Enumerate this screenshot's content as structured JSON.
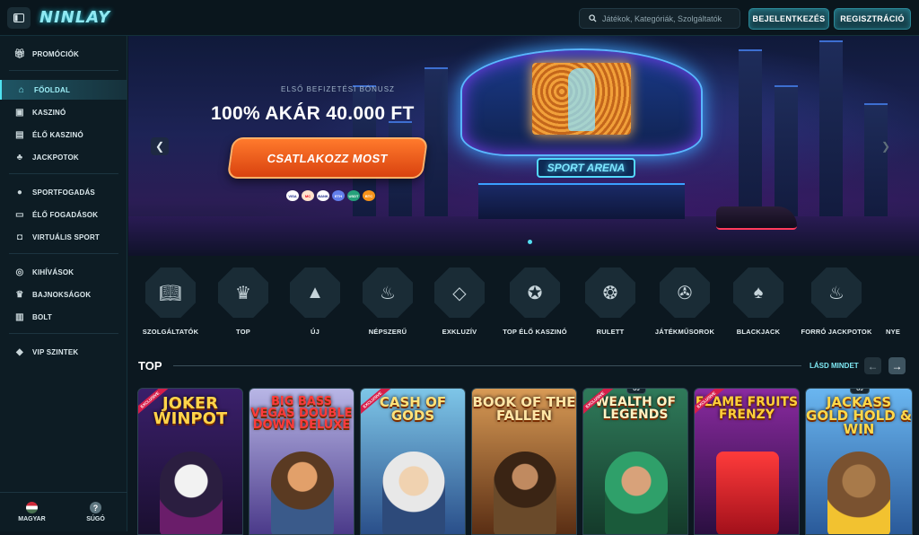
{
  "header": {
    "logo": "NINLAY",
    "search_placeholder": "Játékok, Kategóriák, Szolgáltatók",
    "login_label": "BEJELENTKEZÉS",
    "register_label": "REGISZTRÁCIÓ"
  },
  "sidebar": {
    "items": [
      {
        "label": "PROMÓCIÓK",
        "icon": "gift-icon"
      },
      {
        "label": "FŐOLDAL",
        "icon": "home-icon"
      },
      {
        "label": "KASZINÓ",
        "icon": "slot-machine-icon"
      },
      {
        "label": "ÉLŐ KASZINÓ",
        "icon": "cards-icon"
      },
      {
        "label": "JACKPOTOK",
        "icon": "clover-icon"
      },
      {
        "label": "SPORTFOGADÁS",
        "icon": "soccer-ball-icon"
      },
      {
        "label": "ÉLŐ FOGADÁSOK",
        "icon": "scoreboard-icon"
      },
      {
        "label": "VIRTUÁLIS SPORT",
        "icon": "gamepad-icon"
      },
      {
        "label": "KIHÍVÁSOK",
        "icon": "medal-icon"
      },
      {
        "label": "BAJNOKSÁGOK",
        "icon": "trophy-icon"
      },
      {
        "label": "BOLT",
        "icon": "shop-icon"
      },
      {
        "label": "VIP SZINTEK",
        "icon": "diamond-icon"
      }
    ],
    "active": "FŐOLDAL",
    "language_label": "MAGYAR",
    "help_label": "SÚGÓ",
    "help_glyph": "?"
  },
  "hero": {
    "subtitle": "ELSŐ BEFIZETÉSI BÓNUSZ",
    "title": "100% AKÁR 40.000 FT",
    "cta_label": "CSATLAKOZZ MOST",
    "arena_sign": "SPORT ARENA",
    "payment_methods": [
      "VISA",
      "MC",
      "BANK",
      "ETH",
      "USDT",
      "BTC"
    ]
  },
  "categories": [
    {
      "label": "SZOLGÁLTATÓK",
      "icon": "book-icon"
    },
    {
      "label": "TOP",
      "icon": "crown-icon"
    },
    {
      "label": "ÚJ",
      "icon": "rocket-icon"
    },
    {
      "label": "NÉPSZERŰ",
      "icon": "fire-icon"
    },
    {
      "label": "EXKLUZÍV",
      "icon": "diamond-icon"
    },
    {
      "label": "TOP ÉLŐ KASZINÓ",
      "icon": "rosette-icon"
    },
    {
      "label": "RULETT",
      "icon": "roulette-icon"
    },
    {
      "label": "JÁTÉKMŰSOROK",
      "icon": "wheel-icon"
    },
    {
      "label": "BLACKJACK",
      "icon": "playing-card-icon"
    },
    {
      "label": "FORRÓ JACKPOTOK",
      "icon": "hot-pot-icon"
    },
    {
      "label": "NYE",
      "icon": "more-icon"
    }
  ],
  "top_section": {
    "title": "TOP",
    "see_all_label": "LÁSD MINDET"
  },
  "games": [
    {
      "title": "JOKER WINPOT",
      "exclusive": true,
      "new": false,
      "bg": "#2a1a4a"
    },
    {
      "title": "BIG BASS VEGAS DOUBLE DOWN DELUXE",
      "exclusive": false,
      "new": false,
      "bg": "#3d2a6a"
    },
    {
      "title": "CASH OF GODS",
      "exclusive": true,
      "new": false,
      "bg": "#3b4f7c"
    },
    {
      "title": "BOOK OF THE FALLEN",
      "exclusive": false,
      "new": false,
      "bg": "#5a3a22"
    },
    {
      "title": "WEALTH OF LEGENDS",
      "exclusive": true,
      "new": true,
      "bg": "#1f4a3a"
    },
    {
      "title": "FLAME FRUITS FRENZY",
      "exclusive": true,
      "new": false,
      "bg": "#5a1f5f"
    },
    {
      "title": "JACKASS GOLD HOLD & WIN",
      "exclusive": false,
      "new": true,
      "bg": "#3a6aa0"
    }
  ],
  "badges": {
    "exclusive": "EXCLUSIVE",
    "new": "ÚJ"
  },
  "colors": {
    "accent": "#4ee3f2",
    "cta": "#ff7a2c",
    "background": "#0c1820"
  }
}
